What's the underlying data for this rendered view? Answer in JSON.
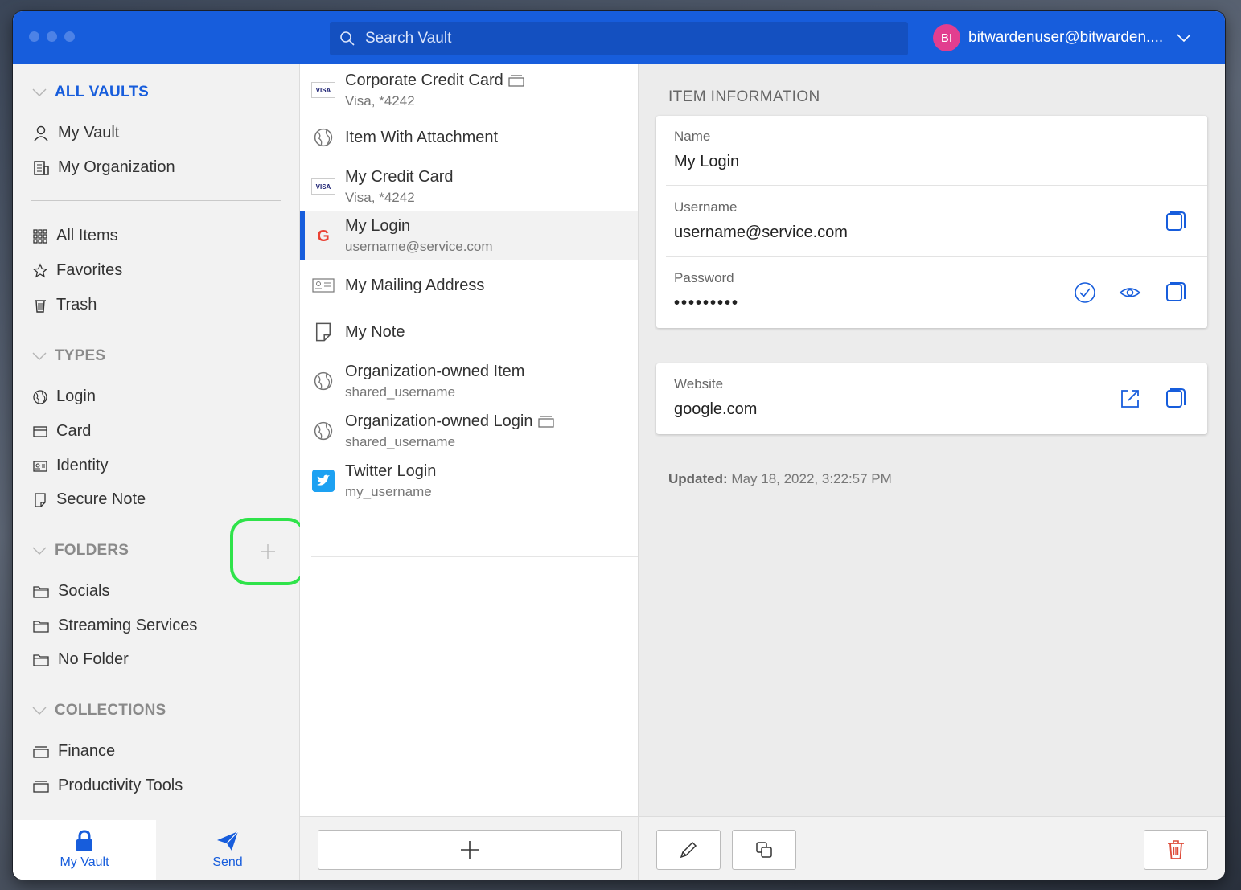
{
  "header": {
    "search_placeholder": "Search Vault",
    "avatar_initials": "BI",
    "account_label": "bitwardenuser@bitwarden...."
  },
  "sidebar": {
    "all_vaults": "ALL VAULTS",
    "vaults": [
      "My Vault",
      "My Organization"
    ],
    "filters": [
      "All Items",
      "Favorites",
      "Trash"
    ],
    "types_header": "TYPES",
    "types": [
      "Login",
      "Card",
      "Identity",
      "Secure Note"
    ],
    "folders_header": "FOLDERS",
    "folders": [
      "Socials",
      "Streaming Services",
      "No Folder"
    ],
    "collections_header": "COLLECTIONS",
    "collections": [
      "Finance",
      "Productivity Tools"
    ]
  },
  "bottom_nav": {
    "vault": "My Vault",
    "send": "Send"
  },
  "items": [
    {
      "name": "Corporate Credit Card",
      "sub": "Visa, *4242"
    },
    {
      "name": "Item With Attachment",
      "sub": ""
    },
    {
      "name": "My Credit Card",
      "sub": "Visa, *4242"
    },
    {
      "name": "My Login",
      "sub": "username@service.com"
    },
    {
      "name": "My Mailing Address",
      "sub": ""
    },
    {
      "name": "My Note",
      "sub": ""
    },
    {
      "name": "Organization-owned Item",
      "sub": "shared_username"
    },
    {
      "name": "Organization-owned Login",
      "sub": "shared_username"
    },
    {
      "name": "Twitter Login",
      "sub": "my_username"
    }
  ],
  "icons": {
    "visa_text": "VISA",
    "google_letter": "G"
  },
  "detail": {
    "section_title": "ITEM INFORMATION",
    "name_label": "Name",
    "name_value": "My Login",
    "username_label": "Username",
    "username_value": "username@service.com",
    "password_label": "Password",
    "password_value": "•••••••••",
    "website_label": "Website",
    "website_value": "google.com",
    "updated_label": "Updated:",
    "updated_value": "May 18, 2022, 3:22:57 PM"
  },
  "colors": {
    "brand": "#175ddc",
    "danger": "#dd4b39",
    "highlight": "#2fe34a"
  }
}
